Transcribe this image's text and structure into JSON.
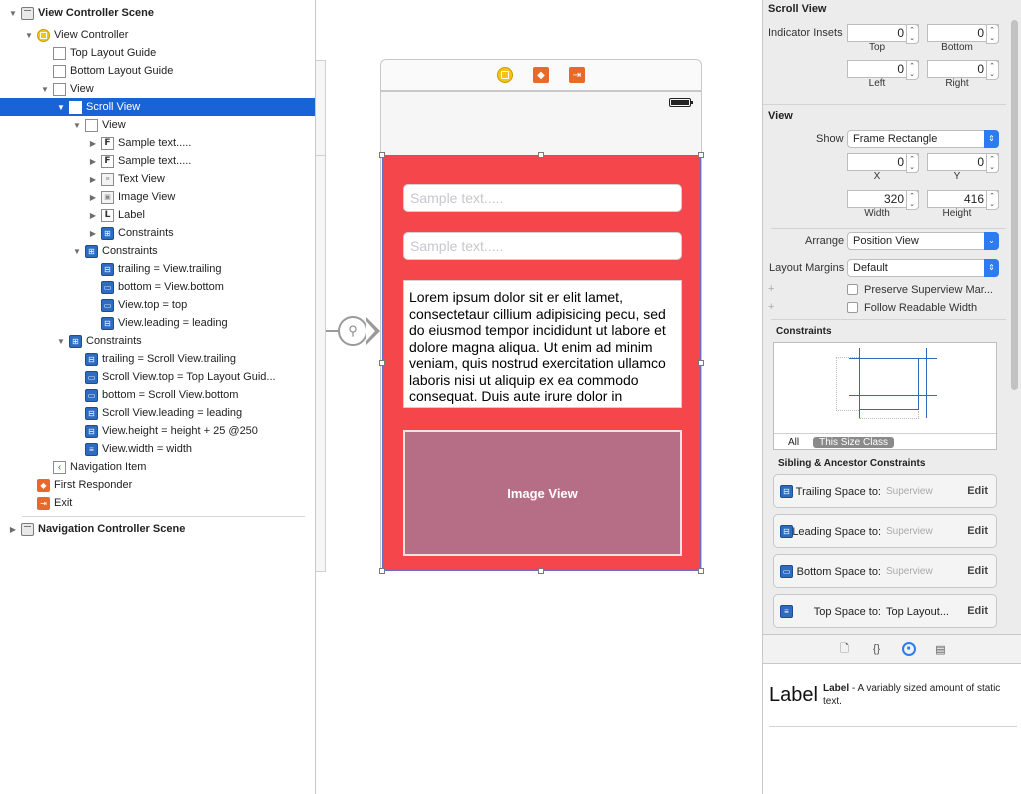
{
  "outline": {
    "rows": [
      {
        "label": "View Controller Scene",
        "indent": 0,
        "icon": "scene-icon",
        "open": true,
        "scene": true
      },
      {
        "label": "View Controller",
        "indent": 1,
        "icon": "view-controller-icon",
        "open": true
      },
      {
        "label": "Top Layout Guide",
        "indent": 2,
        "icon": "layout-guide-icon"
      },
      {
        "label": "Bottom Layout Guide",
        "indent": 2,
        "icon": "layout-guide-icon"
      },
      {
        "label": "View",
        "indent": 2,
        "icon": "view-icon",
        "open": true
      },
      {
        "label": "Scroll View",
        "indent": 3,
        "icon": "scroll-view-icon",
        "open": true,
        "selected": true
      },
      {
        "label": "View",
        "indent": 4,
        "icon": "view-icon",
        "open": true
      },
      {
        "label": "Sample text.....",
        "indent": 5,
        "icon": "text-field-icon",
        "open": false
      },
      {
        "label": "Sample text.....",
        "indent": 5,
        "icon": "text-field-icon",
        "open": false
      },
      {
        "label": "Text View",
        "indent": 5,
        "icon": "text-view-icon",
        "open": false
      },
      {
        "label": "Image View",
        "indent": 5,
        "icon": "image-view-icon",
        "open": false
      },
      {
        "label": "Label",
        "indent": 5,
        "icon": "label-icon",
        "open": false
      },
      {
        "label": "Constraints",
        "indent": 5,
        "icon": "constraints-icon",
        "open": false
      },
      {
        "label": "Constraints",
        "indent": 4,
        "icon": "constraints-icon",
        "open": true
      },
      {
        "label": "trailing = View.trailing",
        "indent": 5,
        "icon": "constraint-trailing-icon"
      },
      {
        "label": "bottom = View.bottom",
        "indent": 5,
        "icon": "constraint-bottom-icon"
      },
      {
        "label": "View.top = top",
        "indent": 5,
        "icon": "constraint-top-icon"
      },
      {
        "label": "View.leading = leading",
        "indent": 5,
        "icon": "constraint-leading-icon"
      },
      {
        "label": "Constraints",
        "indent": 3,
        "icon": "constraints-icon",
        "open": true
      },
      {
        "label": "trailing = Scroll View.trailing",
        "indent": 4,
        "icon": "constraint-trailing-icon"
      },
      {
        "label": "Scroll View.top = Top Layout Guid...",
        "indent": 4,
        "icon": "constraint-top-icon"
      },
      {
        "label": "bottom = Scroll View.bottom",
        "indent": 4,
        "icon": "constraint-bottom-icon"
      },
      {
        "label": "Scroll View.leading = leading",
        "indent": 4,
        "icon": "constraint-leading-icon"
      },
      {
        "label": "View.height = height + 25 @250",
        "indent": 4,
        "icon": "constraint-height-icon"
      },
      {
        "label": "View.width = width",
        "indent": 4,
        "icon": "constraint-width-icon"
      },
      {
        "label": "Navigation Item",
        "indent": 2,
        "icon": "navigation-item-icon"
      },
      {
        "label": "First Responder",
        "indent": 1,
        "icon": "first-responder-icon"
      },
      {
        "label": "Exit",
        "indent": 1,
        "icon": "exit-icon"
      },
      {
        "label": "Navigation Controller Scene",
        "indent": 0,
        "icon": "scene-icon",
        "open": false,
        "scene": true
      }
    ]
  },
  "canvas": {
    "textfield1_placeholder": "Sample text.....",
    "textfield2_placeholder": "Sample text.....",
    "textview_text": "Lorem ipsum dolor sit er elit lamet, consectetaur cillium adipisicing pecu, sed do eiusmod tempor incididunt ut labore et dolore magna aliqua. Ut enim ad minim veniam, quis nostrud exercitation ullamco laboris nisi ut aliquip ex ea commodo consequat. Duis aute irure dolor in",
    "imageview_label": "Image View",
    "scroll_bg_color": "#f5464b",
    "imageview_color": "#b66e87"
  },
  "inspector": {
    "scroll_view_title": "Scroll View",
    "indicator_insets_label": "Indicator Insets",
    "inset_top": "0",
    "inset_bottom": "0",
    "inset_left": "0",
    "inset_right": "0",
    "cap_top": "Top",
    "cap_bottom": "Bottom",
    "cap_left": "Left",
    "cap_right": "Right",
    "view_title": "View",
    "show_label": "Show",
    "show_value": "Frame Rectangle",
    "x_value": "0",
    "y_value": "0",
    "cap_x": "X",
    "cap_y": "Y",
    "width_value": "320",
    "height_value": "416",
    "cap_width": "Width",
    "cap_height": "Height",
    "arrange_label": "Arrange",
    "arrange_value": "Position View",
    "layout_margins_label": "Layout Margins",
    "layout_margins_value": "Default",
    "preserve_label": "Preserve Superview Mar...",
    "follow_label": "Follow Readable Width",
    "constraints_title": "Constraints",
    "tab_all": "All",
    "tab_size_class": "This Size Class",
    "sibling_title": "Sibling & Ancestor Constraints",
    "constraints": [
      {
        "label": "Trailing Space to:",
        "value": "Superview",
        "edit": "Edit",
        "icon": "trailing-space-icon"
      },
      {
        "label": "Leading Space to:",
        "value": "Superview",
        "edit": "Edit",
        "icon": "leading-space-icon"
      },
      {
        "label": "Bottom Space to:",
        "value": "Superview",
        "edit": "Edit",
        "icon": "bottom-space-icon"
      },
      {
        "label": "Top Space to:",
        "value": "Top Layout...",
        "edit": "Edit",
        "icon": "top-space-icon"
      }
    ],
    "accent_color": "#2d7bf0"
  },
  "library": {
    "big_label": "Label",
    "desc_title": "Label",
    "desc_text": " - A variably sized amount of static text."
  }
}
